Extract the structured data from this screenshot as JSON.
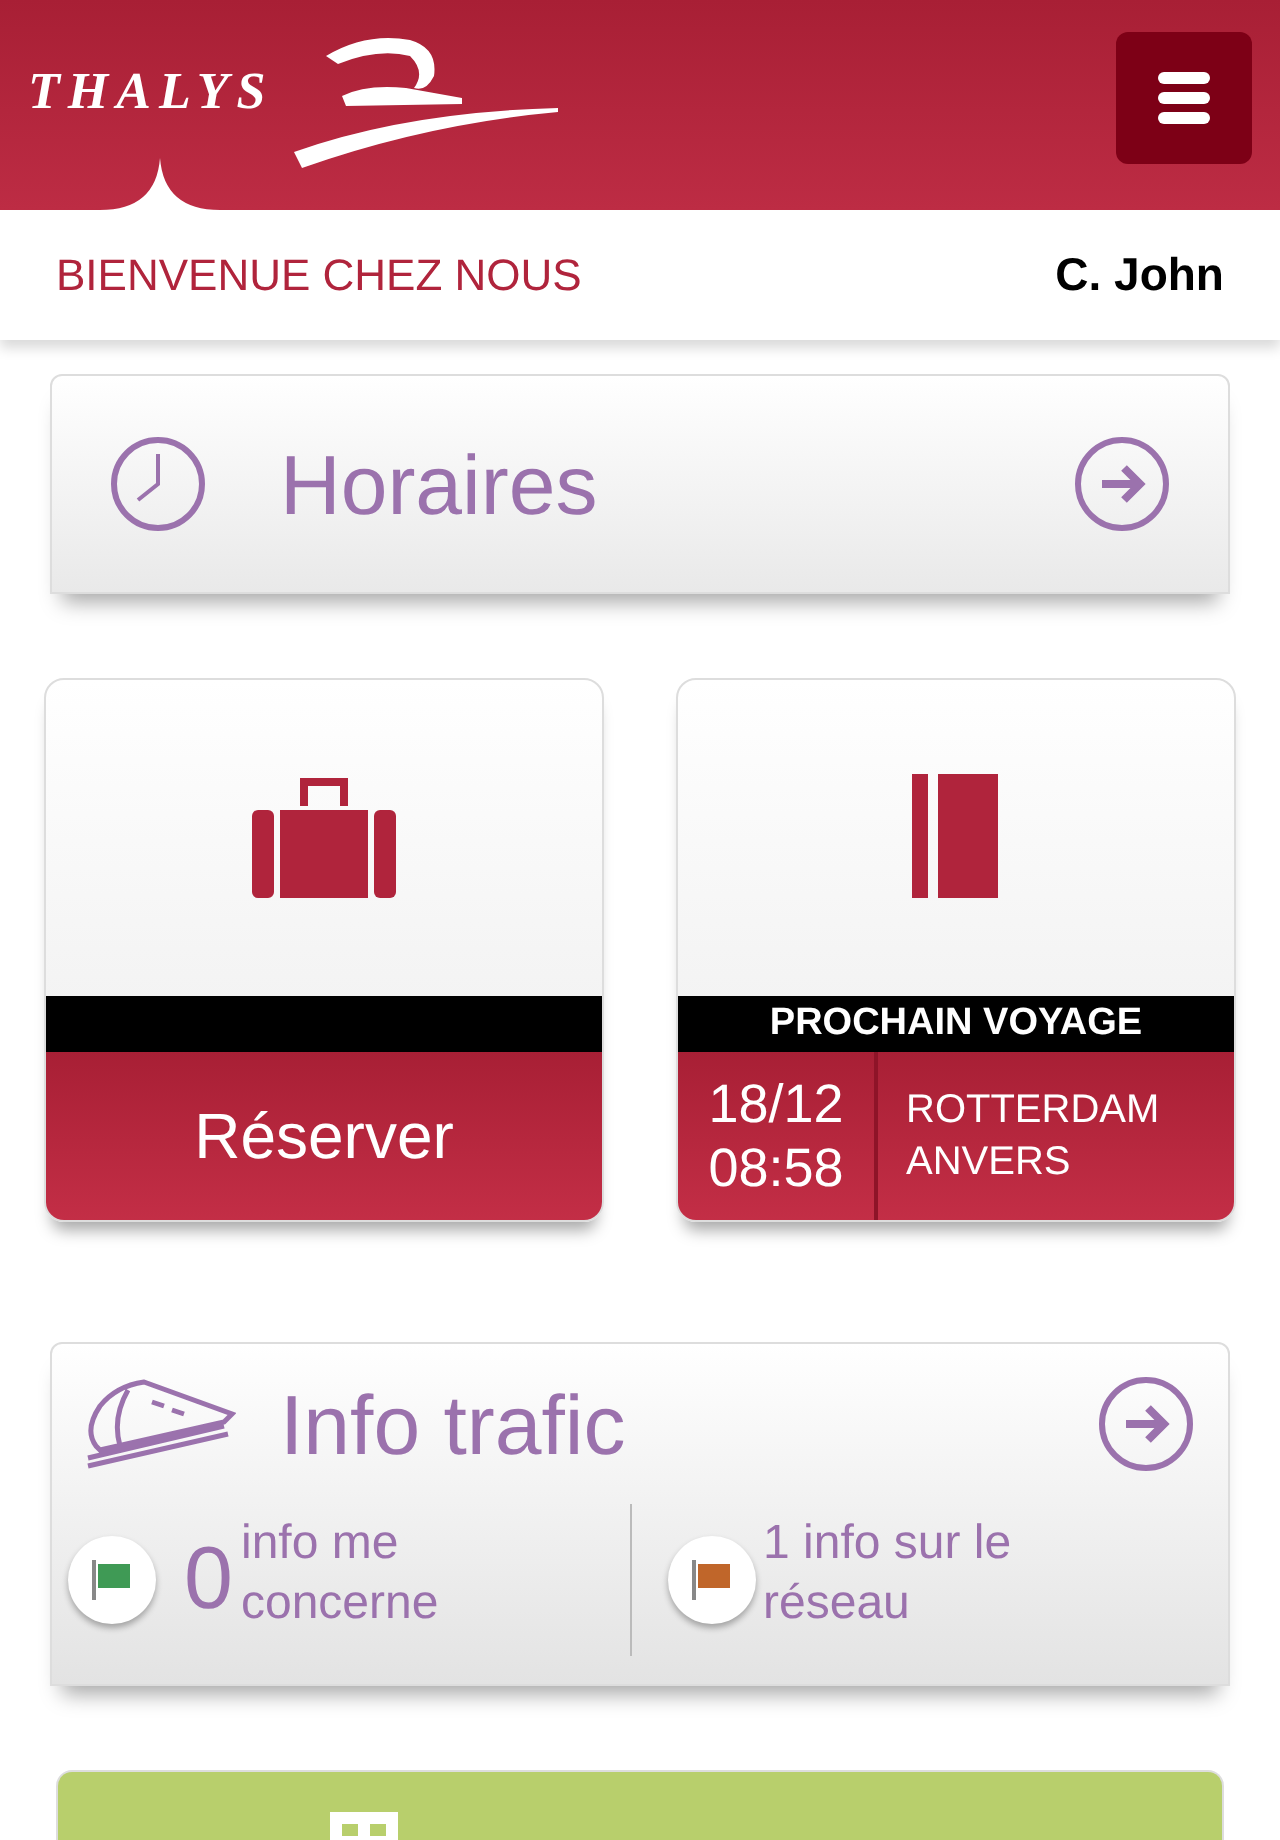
{
  "header": {
    "logo": "THALYS"
  },
  "welcome": {
    "text": "BIENVENUE CHEZ NOUS",
    "user": "C. John"
  },
  "schedule_card": {
    "title": "Horaires"
  },
  "book_tile": {
    "label": "Réserver"
  },
  "next_trip_tile": {
    "banner": "PROCHAIN VOYAGE",
    "date": "18/12",
    "time": "08:58",
    "origin": "ROTTERDAM",
    "destination": "ANVERS"
  },
  "traffic_card": {
    "title": "Info trafic",
    "items": [
      {
        "count": "0",
        "text": "info me concerne",
        "color": "#3f9a55"
      },
      {
        "text": "1 info sur le réseau",
        "color": "#c0662a"
      }
    ]
  }
}
